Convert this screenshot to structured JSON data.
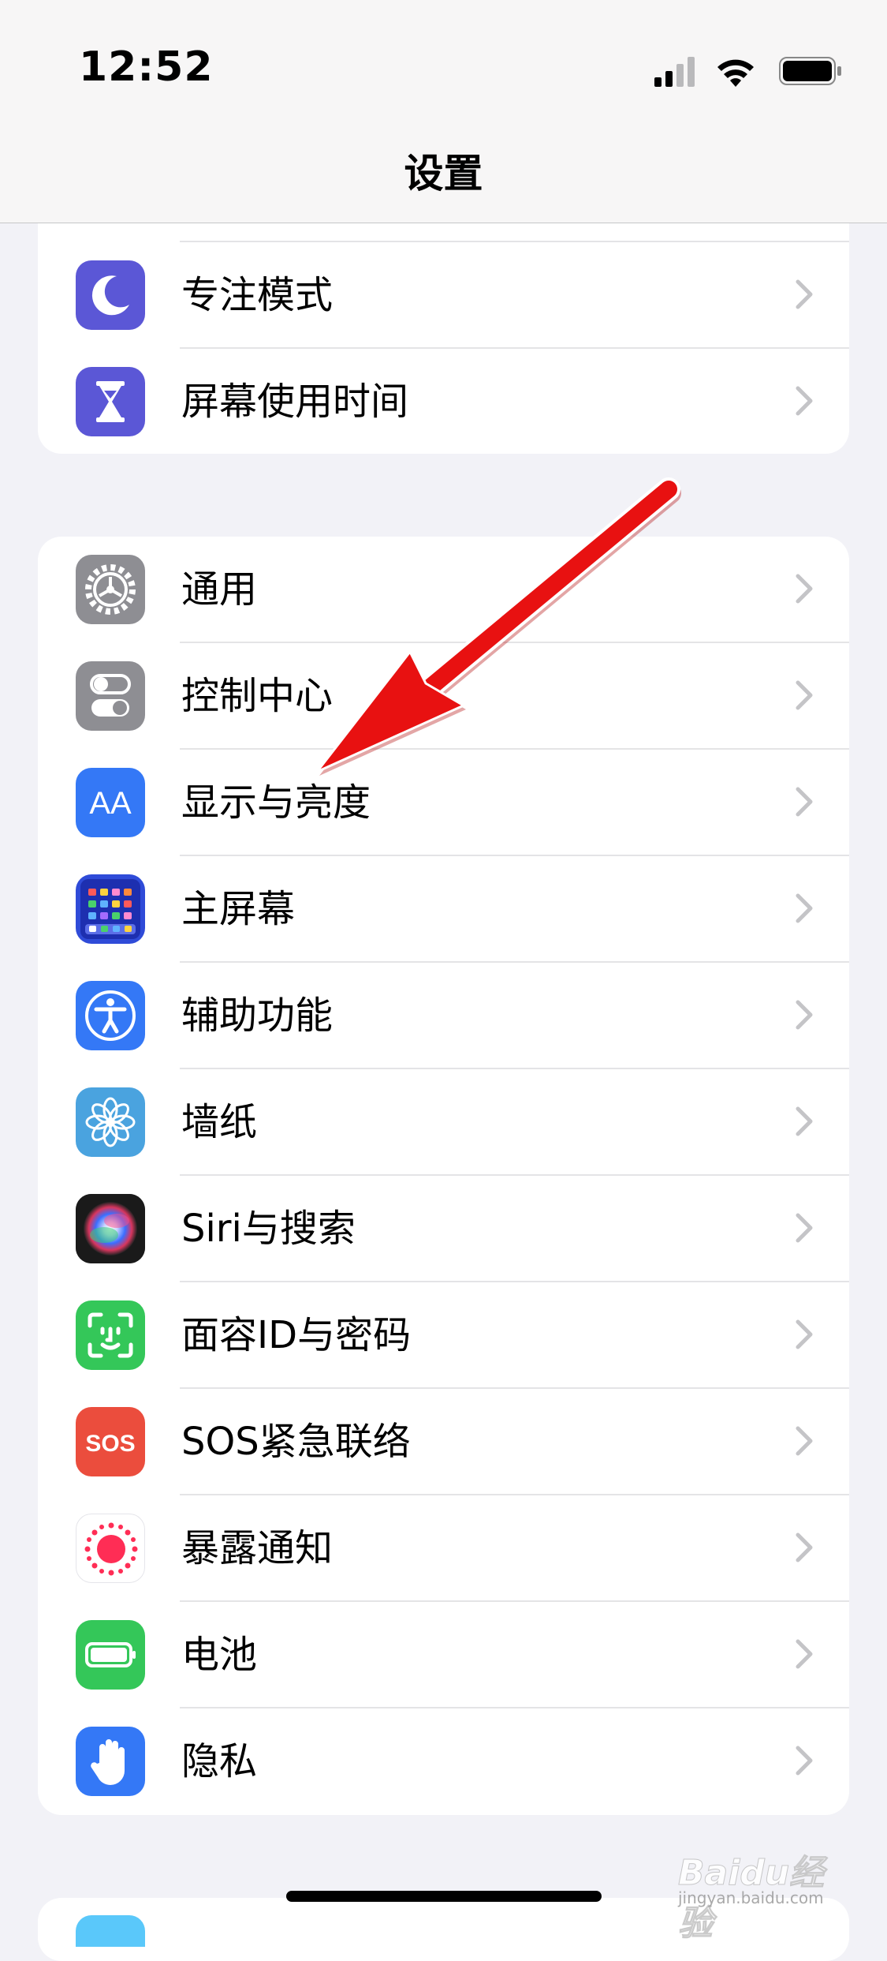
{
  "status": {
    "time": "12:52"
  },
  "nav": {
    "title": "设置"
  },
  "groups": [
    {
      "items": [
        {
          "label": "专注模式",
          "icon": "moon-icon",
          "color": "#5b57d6"
        },
        {
          "label": "屏幕使用时间",
          "icon": "hourglass-icon",
          "color": "#5b57d6"
        }
      ]
    },
    {
      "items": [
        {
          "label": "通用",
          "icon": "gear-icon",
          "color": "#8e8e93"
        },
        {
          "label": "控制中心",
          "icon": "toggles-icon",
          "color": "#8e8e93"
        },
        {
          "label": "显示与亮度",
          "icon": "text-size-icon",
          "color": "#3478f6"
        },
        {
          "label": "主屏幕",
          "icon": "home-grid-icon",
          "color": "#2f4bd8"
        },
        {
          "label": "辅助功能",
          "icon": "accessibility-icon",
          "color": "#3478f6"
        },
        {
          "label": "墙纸",
          "icon": "flower-icon",
          "color": "#4aa3df"
        },
        {
          "label": "Siri与搜索",
          "icon": "siri-icon",
          "color": "#222222"
        },
        {
          "label": "面容ID与密码",
          "icon": "face-id-icon",
          "color": "#34c759"
        },
        {
          "label": "SOS紧急联络",
          "icon": "sos-icon",
          "color": "#eb4d3d"
        },
        {
          "label": "暴露通知",
          "icon": "exposure-icon",
          "color": "#ffffff"
        },
        {
          "label": "电池",
          "icon": "battery-icon",
          "color": "#34c759"
        },
        {
          "label": "隐私",
          "icon": "hand-icon",
          "color": "#3478f6"
        }
      ]
    }
  ],
  "icon_text": {
    "text_size": "AA",
    "sos": "SOS"
  },
  "watermark": {
    "brand": "Baidu经验",
    "url": "jingyan.baidu.com"
  }
}
